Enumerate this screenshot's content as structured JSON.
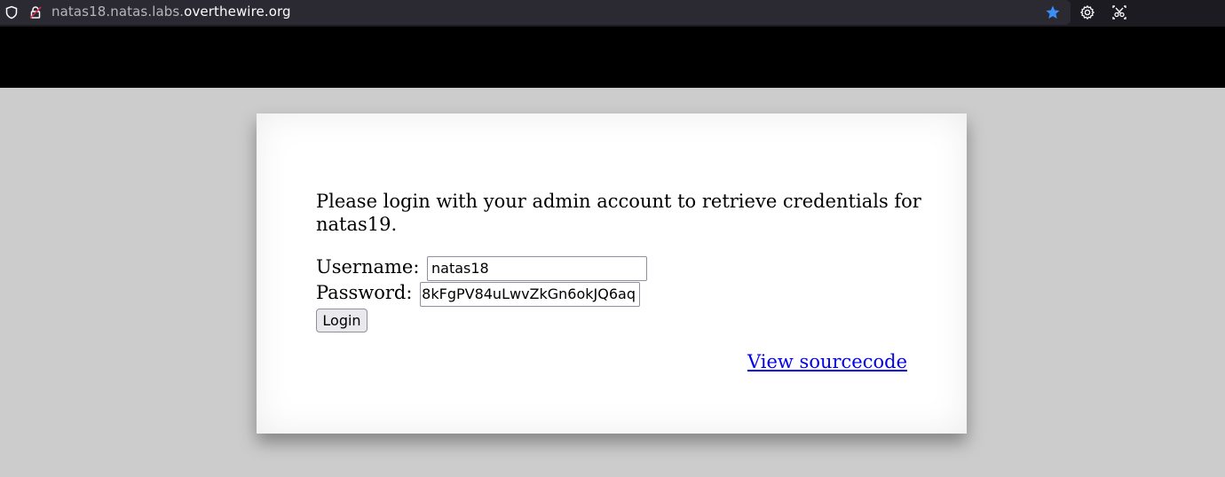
{
  "browser": {
    "url_prefix": "natas18.natas.labs.",
    "url_domain": "overthewire.org",
    "icons": [
      "shield-icon",
      "lock-icon",
      "bookmark-star-icon",
      "settings-gear-icon",
      "screenshot-icon"
    ],
    "colors": {
      "toolbar": "#1c1b22",
      "star": "#0061e0"
    }
  },
  "page": {
    "intro_text": "Please login with your admin account to retrieve credentials for natas19.",
    "username_label": "Username:",
    "username_value": "natas18",
    "password_label": "Password:",
    "password_value": "8kFgPV84uLwvZkGn6okJQ6aq",
    "login_label": "Login",
    "source_link": "View sourcecode",
    "colors": {
      "background": "#cccccc",
      "header": "#000000",
      "link": "#0000ee"
    }
  }
}
